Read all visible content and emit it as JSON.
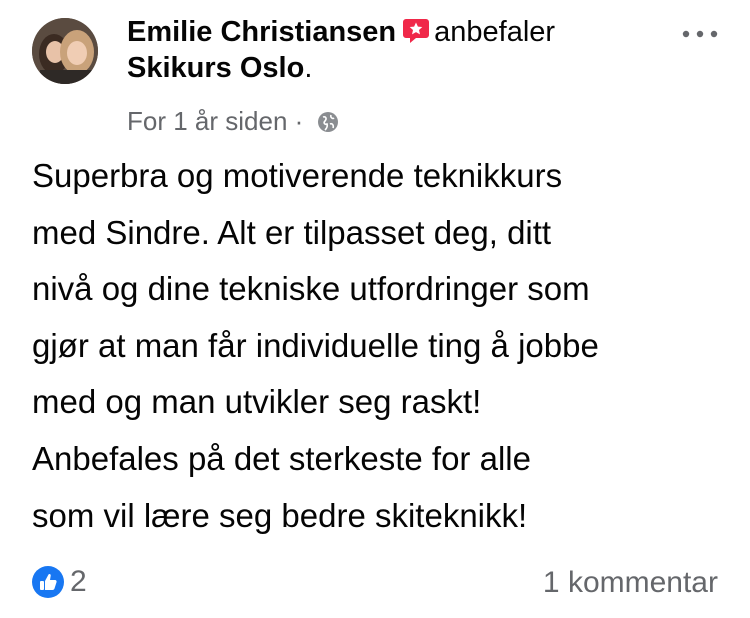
{
  "post": {
    "author": "Emilie Christiansen",
    "verb": "anbefaler",
    "page": "Skikurs Oslo",
    "time": "For 1 år siden",
    "separator": "·",
    "text": "Superbra og motiverende teknikkurs\nmed Sindre. Alt er tilpasset deg, ditt\nnivå og dine tekniske utfordringer som\ngjør at man får individuelle ting å jobbe\nmed og man utvikler seg raskt!\nAnbefales på det sterkeste for alle\nsom vil lære seg bedre skiteknikk!",
    "like_count": "2",
    "comments": "1 kommentar"
  },
  "icons": {
    "recommend": "recommend-star-icon",
    "privacy": "globe-icon",
    "more": "more-dots-icon",
    "like": "thumbs-up-icon"
  },
  "colors": {
    "recommend": "#f02849",
    "like": "#1877f2",
    "secondary_text": "#65676b"
  }
}
